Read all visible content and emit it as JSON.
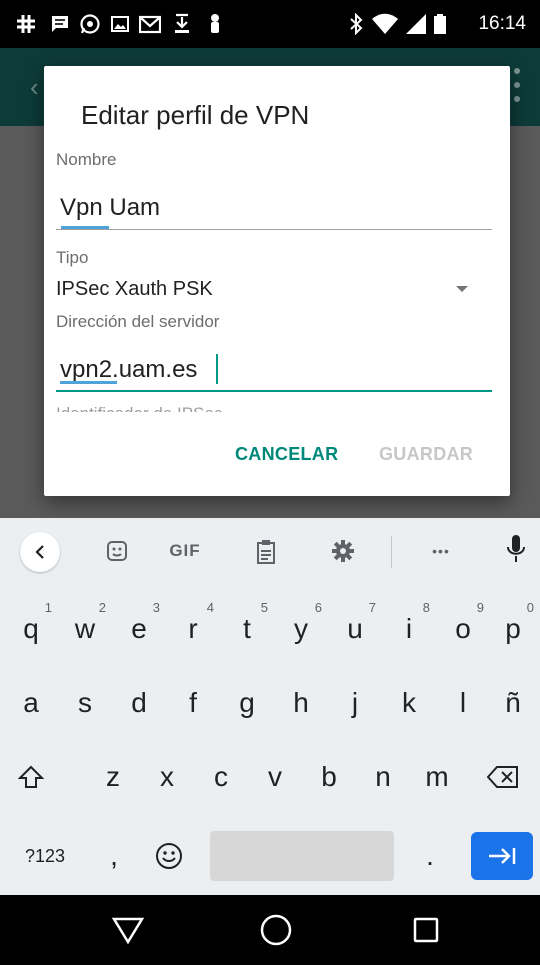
{
  "status_bar": {
    "time": "16:14",
    "icons": [
      "grid-icon",
      "message-icon",
      "whatsapp-icon",
      "image-icon",
      "gmail-icon",
      "download-icon",
      "slack-icon",
      "bluetooth-icon",
      "wifi-icon",
      "signal-icon",
      "battery-icon"
    ]
  },
  "dialog": {
    "title": "Editar perfil de VPN",
    "name_label": "Nombre",
    "name_value": "Vpn Uam",
    "type_label": "Tipo",
    "type_value": "IPSec Xauth PSK",
    "server_label": "Dirección del servidor",
    "server_value": "vpn2.uam.es",
    "next_label_partial": "Identificador de IPSec",
    "cancel_label": "CANCELAR",
    "save_label": "GUARDAR",
    "accent_color": "#009688",
    "disabled_color": "#c7c7c7"
  },
  "keyboard": {
    "toolbar": [
      "back-icon",
      "sticker-icon",
      "GIF",
      "clipboard-icon",
      "gear-icon",
      "more-icon",
      "mic-icon"
    ],
    "gif_label": "GIF",
    "more_label": "•••",
    "row1": [
      "q",
      "w",
      "e",
      "r",
      "t",
      "y",
      "u",
      "i",
      "o",
      "p"
    ],
    "row1_hints": [
      "1",
      "2",
      "3",
      "4",
      "5",
      "6",
      "7",
      "8",
      "9",
      "0"
    ],
    "row2": [
      "a",
      "s",
      "d",
      "f",
      "g",
      "h",
      "j",
      "k",
      "l",
      "ñ"
    ],
    "row3": [
      "z",
      "x",
      "c",
      "v",
      "b",
      "n",
      "m"
    ],
    "symbols_label": "?123",
    "comma_label": ",",
    "period_label": ".",
    "enter_color": "#1a73e8"
  },
  "nav": {
    "buttons": [
      "back-triangle-icon",
      "home-circle-icon",
      "recents-square-icon"
    ]
  }
}
